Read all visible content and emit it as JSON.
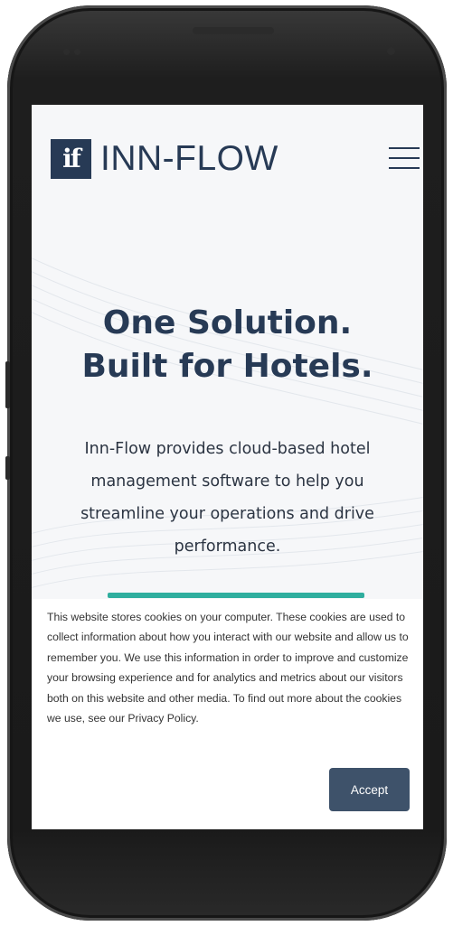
{
  "header": {
    "logo_mark": "if",
    "brand": "INN-FLOW"
  },
  "hero": {
    "title_line1": "One Solution.",
    "title_line2": "Built for Hotels.",
    "subtitle": "Inn-Flow provides cloud-based hotel management software to help you streamline your operations and drive performance."
  },
  "cookie_banner": {
    "message": "This website stores cookies on your computer. These cookies are used to collect information about how you interact with our website and allow us to remember you. We use this information in order to improve and customize your browsing experience and for analytics and metrics about our visitors both on this website and other media. To find out more about the cookies we use, see our Privacy Policy.",
    "accept_label": "Accept"
  },
  "colors": {
    "brand_navy": "#273a55",
    "accent_teal": "#2fae9e",
    "button_bg": "#3e526a"
  },
  "icons": {
    "menu": "hamburger-menu-icon"
  }
}
